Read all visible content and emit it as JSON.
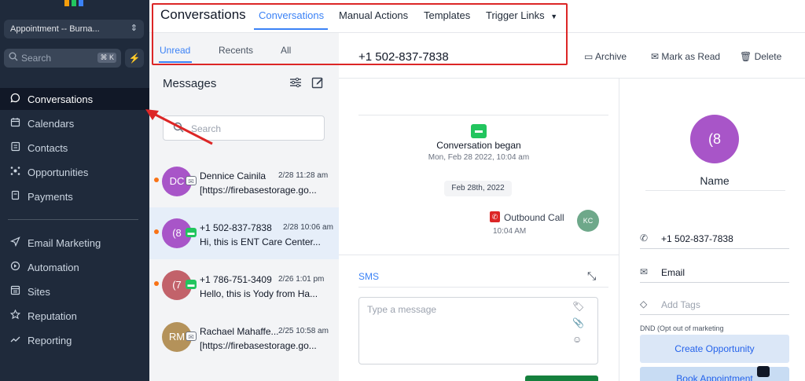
{
  "colors": {
    "sidebar_bg": "#1f2a3b",
    "accent": "#3b82f6",
    "annotation_red": "#dc2626",
    "unread_dot": "#f97316"
  },
  "sidebar": {
    "account_selector": "Appointment -- Burna...",
    "search_placeholder": "Search",
    "search_shortcut": "⌘ K",
    "items": [
      {
        "label": "Conversations",
        "icon": "chat-bubble-icon"
      },
      {
        "label": "Calendars",
        "icon": "calendar-icon"
      },
      {
        "label": "Contacts",
        "icon": "contacts-icon"
      },
      {
        "label": "Opportunities",
        "icon": "network-icon"
      },
      {
        "label": "Payments",
        "icon": "payments-icon"
      },
      {
        "label": "Email Marketing",
        "icon": "send-icon"
      },
      {
        "label": "Automation",
        "icon": "automation-icon"
      },
      {
        "label": "Sites",
        "icon": "sites-icon"
      },
      {
        "label": "Reputation",
        "icon": "star-icon"
      },
      {
        "label": "Reporting",
        "icon": "chart-line-icon"
      }
    ]
  },
  "header": {
    "title": "Conversations",
    "tabs": [
      "Conversations",
      "Manual Actions",
      "Templates",
      "Trigger Links"
    ]
  },
  "list": {
    "subtabs": [
      "Unread",
      "Recents",
      "All"
    ],
    "heading": "Messages",
    "search_placeholder": "Search",
    "conversations": [
      {
        "initials": "DC",
        "name": "Dennice Cainila",
        "time": "2/28 11:28 am",
        "preview": "[https://firebasestorage.go...",
        "channel": "email"
      },
      {
        "initials": "(8",
        "name": "+1 502-837-7838",
        "time": "2/28 10:06 am",
        "preview": "Hi, this is ENT Care Center...",
        "channel": "sms"
      },
      {
        "initials": "(7",
        "name": "+1 786-751-3409",
        "time": "2/26 1:01 pm",
        "preview": "Hello, this is Yody from Ha...",
        "channel": "sms"
      },
      {
        "initials": "RM",
        "name": "Rachael Mahaffe...",
        "time": "2/25 10:58 am",
        "preview": "[https://firebasestorage.go...",
        "channel": "email"
      }
    ]
  },
  "chat": {
    "phone": "+1 502-837-7838",
    "actions": [
      "Archive",
      "Mark as Read",
      "Delete"
    ],
    "began_title": "Conversation began",
    "began_date": "Mon, Feb 28 2022, 10:04 am",
    "date_pill": "Feb 28th, 2022",
    "call_label": "Outbound Call",
    "call_time": "10:04 AM",
    "agent_initials": "KC",
    "composer_tab": "SMS",
    "composer_placeholder": "Type a message"
  },
  "contact": {
    "initials": "(8",
    "name": "Name",
    "phone": "+1 502-837-7838",
    "email_placeholder": "Email",
    "tags_placeholder": "Add Tags",
    "dnd_label": "DND (Opt out of marketing",
    "create_opportunity": "Create Opportunity",
    "book_appointment": "Book Appointment"
  }
}
